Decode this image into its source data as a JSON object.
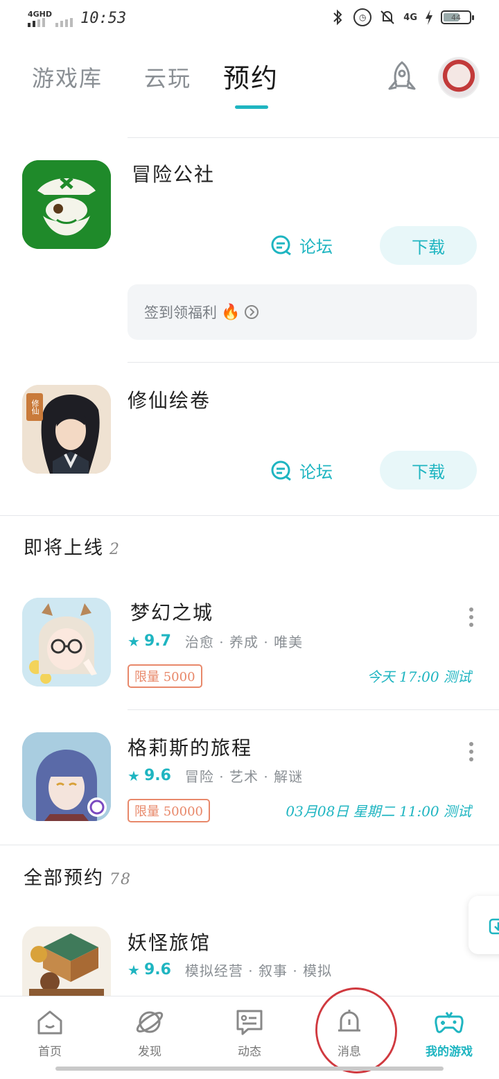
{
  "status_bar": {
    "network": "4GHD",
    "time": "10:53",
    "signal_4g": "4G",
    "battery": "44"
  },
  "tabs": [
    {
      "label": "游戏库",
      "active": false
    },
    {
      "label": "云玩",
      "active": false
    },
    {
      "label": "预约",
      "active": true
    }
  ],
  "installed": [
    {
      "title": "冒险公社",
      "forum_label": "论坛",
      "download_label": "下载",
      "signin_text": "签到领福利"
    },
    {
      "title": "修仙绘卷",
      "forum_label": "论坛",
      "download_label": "下载",
      "icon_badge": "修仙"
    }
  ],
  "upcoming": {
    "title": "即将上线",
    "count": "2",
    "items": [
      {
        "title": "梦幻之城",
        "score": "9.7",
        "tags": "治愈 · 养成 · 唯美",
        "limit": "限量 5000",
        "test_time": "今天 17:00 测试"
      },
      {
        "title": "格莉斯的旅程",
        "score": "9.6",
        "tags": "冒险 · 艺术 · 解谜",
        "limit": "限量 50000",
        "test_time": "03月08日 星期二 11:00 测试"
      }
    ]
  },
  "all_reservations": {
    "title": "全部预约",
    "count": "78",
    "items": [
      {
        "title": "妖怪旅馆",
        "score": "9.6",
        "tags": "模拟经营 · 叙事 · 模拟"
      }
    ]
  },
  "bottom_nav": [
    {
      "label": "首页",
      "icon": "home-icon",
      "active": false
    },
    {
      "label": "发现",
      "icon": "planet-icon",
      "active": false
    },
    {
      "label": "动态",
      "icon": "chat-card-icon",
      "active": false
    },
    {
      "label": "消息",
      "icon": "bell-icon",
      "active": false
    },
    {
      "label": "我的游戏",
      "icon": "gamepad-icon",
      "active": true
    }
  ],
  "colors": {
    "accent": "#1fb5c1",
    "limit": "#e8886a",
    "annotation_circle": "#d0393f"
  }
}
